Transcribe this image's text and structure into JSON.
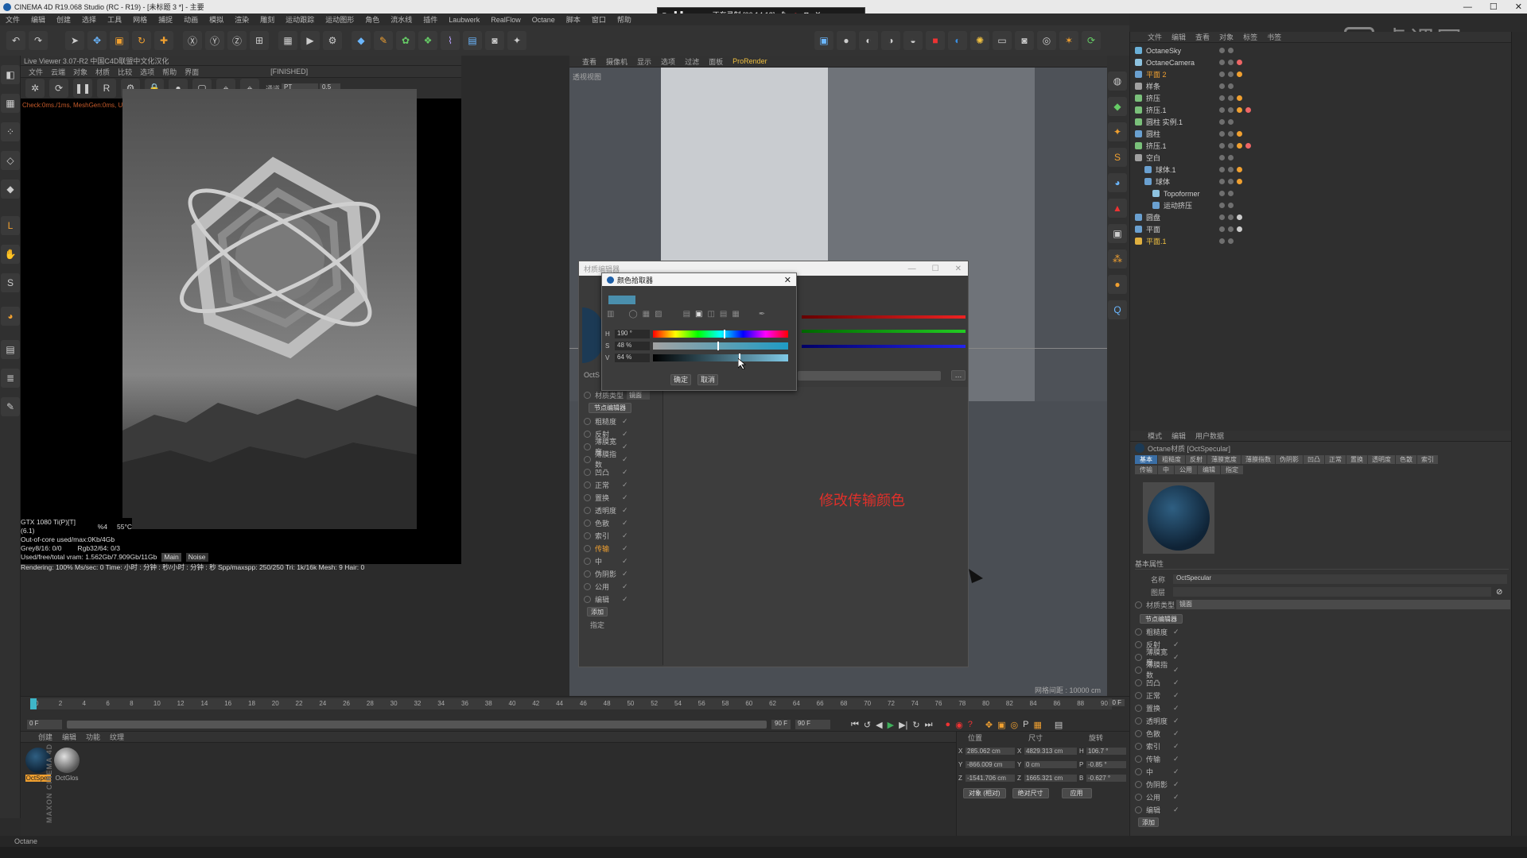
{
  "window": {
    "title": "CINEMA 4D R19.068 Studio (RC - R19) - [未标题 3 *] - 主要",
    "min": "—",
    "max": "☐",
    "close": "✕"
  },
  "recording": {
    "status": "正在录制 [00:14:12]"
  },
  "watermark": "虎课网",
  "menubar": [
    "文件",
    "编辑",
    "创建",
    "选择",
    "工具",
    "网格",
    "捕捉",
    "动画",
    "模拟",
    "渲染",
    "雕刻",
    "运动跟踪",
    "运动图形",
    "角色",
    "流水线",
    "插件",
    "Laubwerk",
    "RealFlow",
    "Octane",
    "脚本",
    "窗口",
    "帮助"
  ],
  "live_viewer": {
    "title": "Live Viewer 3.07-R2 中国C4D联盟中文化汉化",
    "menu": [
      "文件",
      "云端",
      "对象",
      "材质",
      "比较",
      "选项",
      "帮助",
      "界面"
    ],
    "state": "[FINISHED]",
    "channel_label": "通道",
    "channel_value": "PT",
    "channel_num": "0.5",
    "check_line": "Check:0ms./1ms, MeshGen:0ms, Update[C]:0ms, Nodes:0 Movable:0 0",
    "gpu": "GTX 1080 Ti(P)[T](6.1)",
    "gpu_pct": "%4",
    "gpu_temp": "55°C",
    "out_of_core": "Out-of-core used/max:0Kb/4Gb",
    "grey": "Grey8/16: 0/0",
    "rgb": "Rgb32/64: 0/3",
    "vram": "Used/free/total vram: 1.562Gb/7.909Gb/11Gb",
    "tabs": [
      "Main",
      "Noise"
    ],
    "render_line": "Rendering: 100%   Ms/sec: 0   Time: 小时 : 分钟 : 秒/小时 : 分钟 : 秒   Spp/maxspp: 250/250   Tri: 1k/16k   Mesh: 9   Hair: 0"
  },
  "viewport": {
    "menu": [
      "查看",
      "摄像机",
      "显示",
      "选项",
      "过滤",
      "面板",
      "ProRender"
    ],
    "name": "透视视图",
    "grid": "网格间距 : 10000 cm"
  },
  "annotation": "修改传输颜色",
  "material_editor": {
    "title": "材质编辑器",
    "name_short": "OctS",
    "type_label": "材质类型",
    "type_value": "镜面",
    "node_editor_btn": "节点编辑器",
    "channels": [
      "粗糙度",
      "反射",
      "薄膜宽度",
      "薄膜指数",
      "凹凸",
      "正常",
      "置换",
      "透明度",
      "色散",
      "索引",
      "传输",
      "中",
      "伪阴影",
      "公用",
      "编辑"
    ],
    "active_channel": "传输",
    "add_btn": "添加",
    "assign": "指定"
  },
  "color_picker": {
    "title": "颜色拾取器",
    "swatch": "#4a8fad",
    "h_label": "H",
    "h_value": "190 °",
    "s_label": "S",
    "s_value": "48 %",
    "v_label": "V",
    "v_value": "64 %",
    "h_level": 0.53,
    "s_level": 0.48,
    "v_level": 0.64,
    "ok": "确定",
    "cancel": "取消"
  },
  "objects_panel": {
    "menu": [
      "文件",
      "编辑",
      "查看",
      "对象",
      "标签",
      "书签"
    ],
    "items": [
      {
        "name": "OctaneSky",
        "color": "#6ab0d8",
        "indent": 0
      },
      {
        "name": "OctaneCamera",
        "color": "#8ec3e0",
        "indent": 0
      },
      {
        "name": "平面 2",
        "color": "#6aa0d0",
        "indent": 0,
        "hl": true
      },
      {
        "name": "样条",
        "color": "#a0a0a0",
        "indent": 0
      },
      {
        "name": "挤压",
        "color": "#7ac07a",
        "indent": 0
      },
      {
        "name": "挤压.1",
        "color": "#7ac07a",
        "indent": 0
      },
      {
        "name": "圆柱 实例.1",
        "color": "#7ac07a",
        "indent": 0
      },
      {
        "name": "圆柱",
        "color": "#6aa0d0",
        "indent": 0
      },
      {
        "name": "挤压.1",
        "color": "#7ac07a",
        "indent": 0
      },
      {
        "name": "空白",
        "color": "#a0a0a0",
        "indent": 0
      },
      {
        "name": "球体.1",
        "color": "#6aa0d0",
        "indent": 1
      },
      {
        "name": "球体",
        "color": "#6aa0d0",
        "indent": 1
      },
      {
        "name": "Topoformer",
        "color": "#8ec3e0",
        "indent": 2
      },
      {
        "name": "运动挤压",
        "color": "#6aa0d0",
        "indent": 2
      },
      {
        "name": "圆盘",
        "color": "#6aa0d0",
        "indent": 0
      },
      {
        "name": "平面",
        "color": "#6aa0d0",
        "indent": 0
      },
      {
        "name": "平面.1",
        "color": "#e0b040",
        "indent": 0,
        "hl": true
      }
    ]
  },
  "attributes": {
    "menu": [
      "模式",
      "编辑",
      "用户数据"
    ],
    "title": "Octane材质 [OctSpecular]",
    "tabs_row1": [
      "基本",
      "粗糙度",
      "反射",
      "薄膜宽度",
      "薄膜指数",
      "伪阴影",
      "凹凸",
      "正常",
      "置换",
      "透明度",
      "色散",
      "索引"
    ],
    "tabs_row2": [
      "传输",
      "中",
      "公用",
      "编辑",
      "指定"
    ],
    "section": "基本属性",
    "name_label": "名称",
    "name_value": "OctSpecular",
    "layer_label": "图层",
    "type_label": "材质类型",
    "type_value": "镜面",
    "node_btn": "节点编辑器",
    "channels": [
      "粗糙度",
      "反射",
      "薄膜宽度",
      "薄膜指数",
      "凹凸",
      "正常",
      "置换",
      "透明度",
      "色散",
      "索引",
      "传输",
      "中",
      "伪阴影",
      "公用",
      "编辑"
    ],
    "add_btn": "添加"
  },
  "timeline": {
    "ticks": [
      "0",
      "2",
      "4",
      "6",
      "8",
      "10",
      "12",
      "14",
      "16",
      "18",
      "20",
      "22",
      "24",
      "26",
      "28",
      "30",
      "32",
      "34",
      "36",
      "38",
      "40",
      "42",
      "44",
      "46",
      "48",
      "50",
      "52",
      "54",
      "56",
      "58",
      "60",
      "62",
      "64",
      "66",
      "68",
      "70",
      "72",
      "74",
      "76",
      "78",
      "80",
      "82",
      "84",
      "86",
      "88",
      "90"
    ],
    "frame_field": "0 F",
    "start": "0 F",
    "end": "90 F",
    "end2": "90 F",
    "current": "0 F"
  },
  "materials": {
    "menu": [
      "创建",
      "编辑",
      "功能",
      "纹理"
    ],
    "items": [
      "OctSpec",
      "OctGlos"
    ]
  },
  "coords": {
    "headers": [
      "位置",
      "尺寸",
      "旋转"
    ],
    "rows": [
      [
        "X",
        "285.062 cm",
        "X",
        "4829.313 cm",
        "H",
        "106.7 °"
      ],
      [
        "Y",
        "-866.009 cm",
        "Y",
        "0 cm",
        "P",
        "-0.85 °"
      ],
      [
        "Z",
        "-1541.706 cm",
        "Z",
        "1665.321 cm",
        "B",
        "-0.627 °"
      ]
    ],
    "mode1": "对象 (相对)",
    "mode2": "绝对尺寸",
    "apply": "应用"
  },
  "status": "Octane",
  "maxon": "MAXON CINEMA 4D"
}
